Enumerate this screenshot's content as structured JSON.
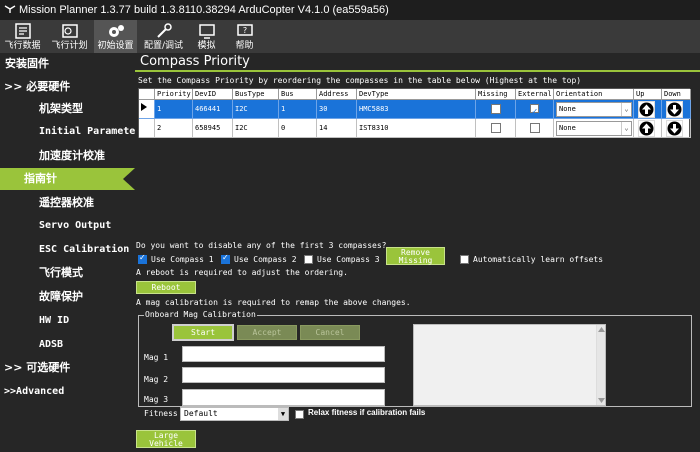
{
  "window": {
    "title": "Mission Planner 1.3.77 build 1.3.8110.38294 ArduCopter V4.1.0 (ea559a56)"
  },
  "toolbar": {
    "items": [
      {
        "label": "飞行数据",
        "icon": "flight-data-icon"
      },
      {
        "label": "飞行计划",
        "icon": "flight-plan-icon"
      },
      {
        "label": "初始设置",
        "icon": "initial-setup-icon"
      },
      {
        "label": "配置/调试",
        "icon": "config-tuning-icon"
      },
      {
        "label": "模拟",
        "icon": "simulation-icon"
      },
      {
        "label": "帮助",
        "icon": "help-icon"
      }
    ]
  },
  "sidebar": {
    "header": "安装固件",
    "group_required": "必要硬件",
    "items": [
      "机架类型",
      "Initial Parameter Setup",
      "加速度计校准",
      "指南针",
      "遥控器校准",
      "Servo Output",
      "ESC Calibration",
      "飞行模式",
      "故障保护",
      "HW ID",
      "ADSB"
    ],
    "group_optional": "可选硬件",
    "group_advanced": "Advanced",
    "selected": "指南针"
  },
  "panel": {
    "title": "Compass Priority",
    "instructions": "Set the Compass Priority by reordering the compasses in the table below (Highest at the top)"
  },
  "table": {
    "columns": [
      "Priority",
      "DevID",
      "BusType",
      "Bus",
      "Address",
      "DevType",
      "Missing",
      "External",
      "Orientation",
      "Up",
      "Down"
    ],
    "rows": [
      {
        "priority": "1",
        "devid": "466441",
        "bustype": "I2C",
        "bus": "1",
        "address": "30",
        "devtype": "HMC5883",
        "missing": false,
        "external": true,
        "orientation": "None"
      },
      {
        "priority": "2",
        "devid": "658945",
        "bustype": "I2C",
        "bus": "0",
        "address": "14",
        "devtype": "IST8310",
        "missing": false,
        "external": false,
        "orientation": "None"
      }
    ]
  },
  "disable": {
    "question": "Do you want to disable any of the first 3 compasses?",
    "use1": "Use Compass 1",
    "use2": "Use Compass 2",
    "use3": "Use Compass 3",
    "use1_checked": true,
    "use2_checked": true,
    "use3_checked": false,
    "remove_missing": "Remove Missing",
    "auto_learn": "Automatically learn offsets",
    "auto_learn_checked": false,
    "reboot_note": "A reboot is required to adjust the ordering.",
    "reboot_button": "Reboot",
    "remap_note": "A mag calibration is required to remap the above changes."
  },
  "onboard": {
    "group_title": "Onboard Mag Calibration",
    "start": "Start",
    "accept": "Accept",
    "cancel": "Cancel",
    "mag1": "Mag 1",
    "mag2": "Mag 2",
    "mag3": "Mag 3",
    "fitness_label": "Fitness",
    "fitness_value": "Default",
    "relax": "Relax fitness if calibration fails",
    "large_vehicle": "Large Vehicle MagCal"
  },
  "colors": {
    "accent": "#9ac43b",
    "selection": "#1a73d9",
    "background": "#262626"
  }
}
